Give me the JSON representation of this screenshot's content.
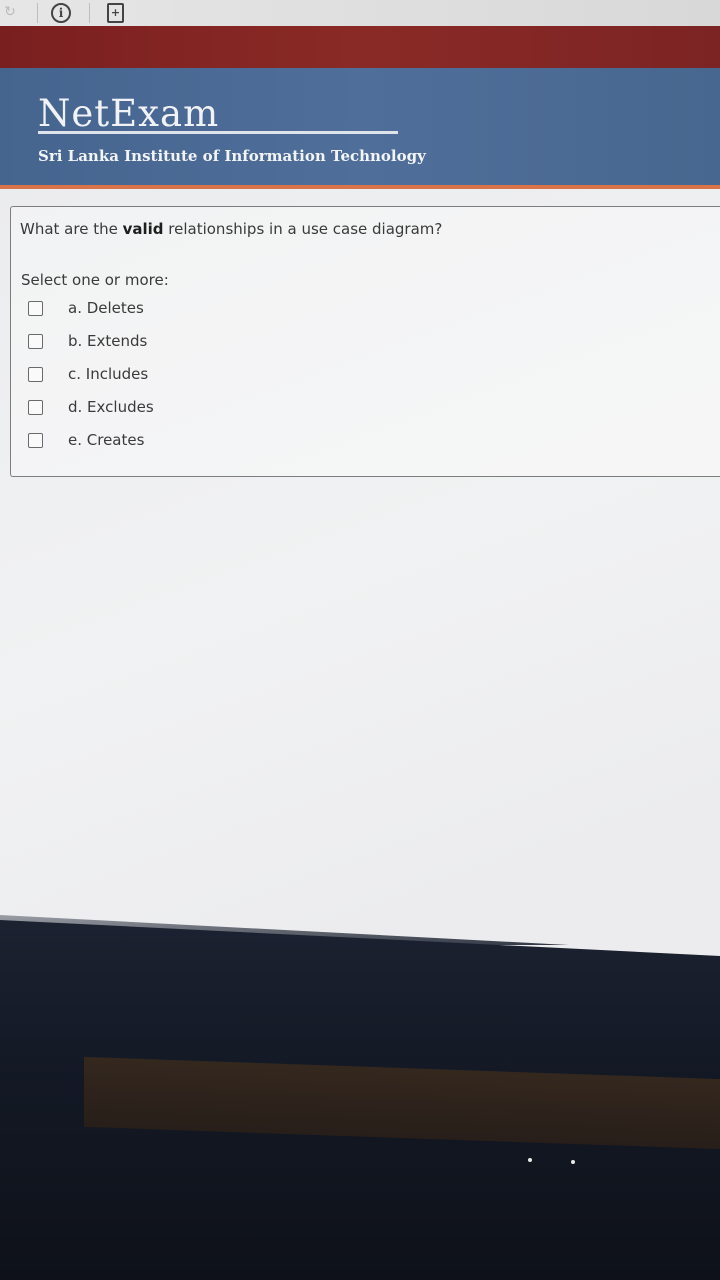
{
  "header": {
    "logo_text": "NetExam",
    "institute": "Sri Lanka Institute of Information Technology"
  },
  "question": {
    "text_before": "What are the ",
    "text_bold": "valid",
    "text_after": " relationships in a use case diagram?",
    "prompt": "Select one or more:",
    "options": [
      {
        "label": "a. Deletes",
        "checked": false
      },
      {
        "label": "b. Extends",
        "checked": false
      },
      {
        "label": "c. Includes",
        "checked": false
      },
      {
        "label": "d. Excludes",
        "checked": false
      },
      {
        "label": "e. Creates",
        "checked": false
      }
    ]
  },
  "icons": {
    "reload": "reload-icon",
    "info": "info-icon",
    "page": "page-action-icon"
  },
  "colors": {
    "header_blue": "#4f6e9a",
    "top_band_red": "#8a2a26",
    "accent_orange": "#d9744a"
  }
}
